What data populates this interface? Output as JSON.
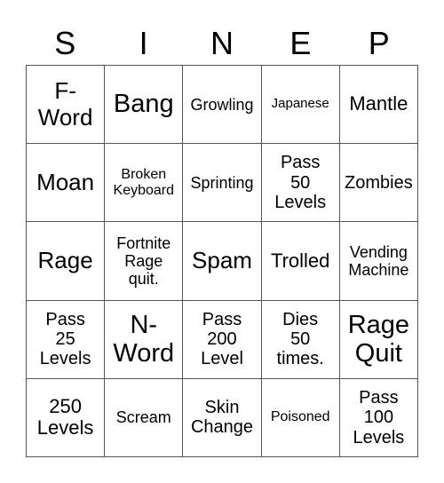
{
  "header": {
    "letters": [
      "S",
      "I",
      "N",
      "E",
      "P"
    ]
  },
  "cells": [
    [
      "F-\nWord",
      "Bang",
      "Growling",
      "Japanese",
      "Mantle"
    ],
    [
      "Moan",
      "Broken\nKeyboard",
      "Sprinting",
      "Pass\n50\nLevels",
      "Zombies"
    ],
    [
      "Rage",
      "Fortnite\nRage\nquit.",
      "Spam",
      "Trolled",
      "Vending\nMachine"
    ],
    [
      "Pass\n25\nLevels",
      "N-\nWord",
      "Pass\n200\nLevel",
      "Dies\n50\ntimes.",
      "Rage\nQuit"
    ],
    [
      "250\nLevels",
      "Scream",
      "Skin\nChange",
      "Poisoned",
      "Pass\n100\nLevels"
    ]
  ]
}
